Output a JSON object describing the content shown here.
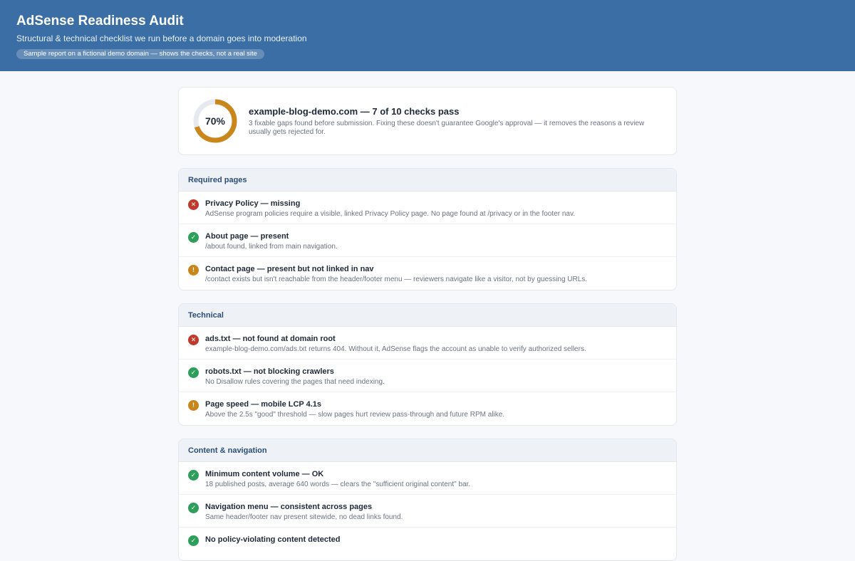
{
  "header": {
    "title": "AdSense Readiness Audit",
    "subtitle": "Structural & technical checklist we run before a domain goes into moderation",
    "badge": "Sample report on a fictional demo domain — shows the checks, not a real site"
  },
  "summary": {
    "score": 0.7,
    "score_label": "70%",
    "title": "example-blog-demo.com — 7 of 10 checks pass",
    "description": "3 fixable gaps found before submission. Fixing these doesn't guarantee Google's approval — it removes the reasons a review usually gets rejected for.",
    "ring_color": "#c9861a",
    "ring_track_color": "#e6e9ef"
  },
  "colors": {
    "pass": "#2e9e5b",
    "fail": "#c0392b",
    "warn": "#c9861a"
  },
  "sections": [
    {
      "title": "Required pages",
      "items": [
        {
          "status": "fail",
          "icon": "x-icon",
          "glyph": "✕",
          "title": "Privacy Policy — missing",
          "desc": "AdSense program policies require a visible, linked Privacy Policy page. No page found at /privacy or in the footer nav."
        },
        {
          "status": "pass",
          "icon": "check-icon",
          "glyph": "✓",
          "title": "About page — present",
          "desc": "/about found, linked from main navigation."
        },
        {
          "status": "warn",
          "icon": "exclamation-icon",
          "glyph": "!",
          "title": "Contact page — present but not linked in nav",
          "desc": "/contact exists but isn't reachable from the header/footer menu — reviewers navigate like a visitor, not by guessing URLs."
        }
      ]
    },
    {
      "title": "Technical",
      "items": [
        {
          "status": "fail",
          "icon": "x-icon",
          "glyph": "✕",
          "title": "ads.txt — not found at domain root",
          "desc": "example-blog-demo.com/ads.txt returns 404. Without it, AdSense flags the account as unable to verify authorized sellers."
        },
        {
          "status": "pass",
          "icon": "check-icon",
          "glyph": "✓",
          "title": "robots.txt — not blocking crawlers",
          "desc": "No Disallow rules covering the pages that need indexing."
        },
        {
          "status": "warn",
          "icon": "exclamation-icon",
          "glyph": "!",
          "title": "Page speed — mobile LCP 4.1s",
          "desc": "Above the 2.5s \"good\" threshold — slow pages hurt review pass-through and future RPM alike."
        }
      ]
    },
    {
      "title": "Content & navigation",
      "items": [
        {
          "status": "pass",
          "icon": "check-icon",
          "glyph": "✓",
          "title": "Minimum content volume — OK",
          "desc": "18 published posts, average 640 words — clears the \"sufficient original content\" bar."
        },
        {
          "status": "pass",
          "icon": "check-icon",
          "glyph": "✓",
          "title": "Navigation menu — consistent across pages",
          "desc": "Same header/footer nav present sitewide, no dead links found."
        },
        {
          "status": "pass",
          "icon": "check-icon",
          "glyph": "✓",
          "title": "No policy-violating content detected",
          "desc": ""
        }
      ]
    }
  ]
}
